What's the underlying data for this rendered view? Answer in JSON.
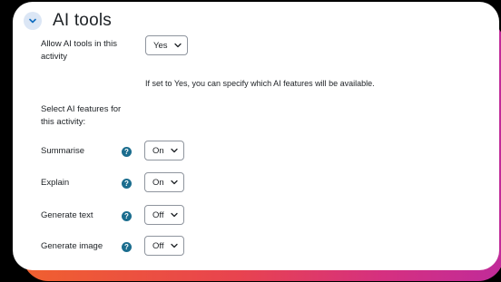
{
  "section": {
    "title": "AI tools",
    "collapse_icon": "chevron-down-icon"
  },
  "allow": {
    "label_line1": "Allow AI tools in this",
    "label_line2": "activity",
    "value": "Yes"
  },
  "note": "If set to Yes, you can specify which AI features will be available.",
  "features_heading": {
    "line1": "Select AI features for",
    "line2": "this activity:"
  },
  "features": [
    {
      "label": "Summarise",
      "value": "On"
    },
    {
      "label": "Explain",
      "value": "On"
    },
    {
      "label": "Generate text",
      "value": "Off"
    },
    {
      "label": "Generate image",
      "value": "Off"
    }
  ],
  "help_glyph": "?",
  "colors": {
    "accent": "#1b6d8e",
    "chevron_bg": "#dbe6f5",
    "glow_start": "#f0602f",
    "glow_end": "#c02b9a"
  }
}
